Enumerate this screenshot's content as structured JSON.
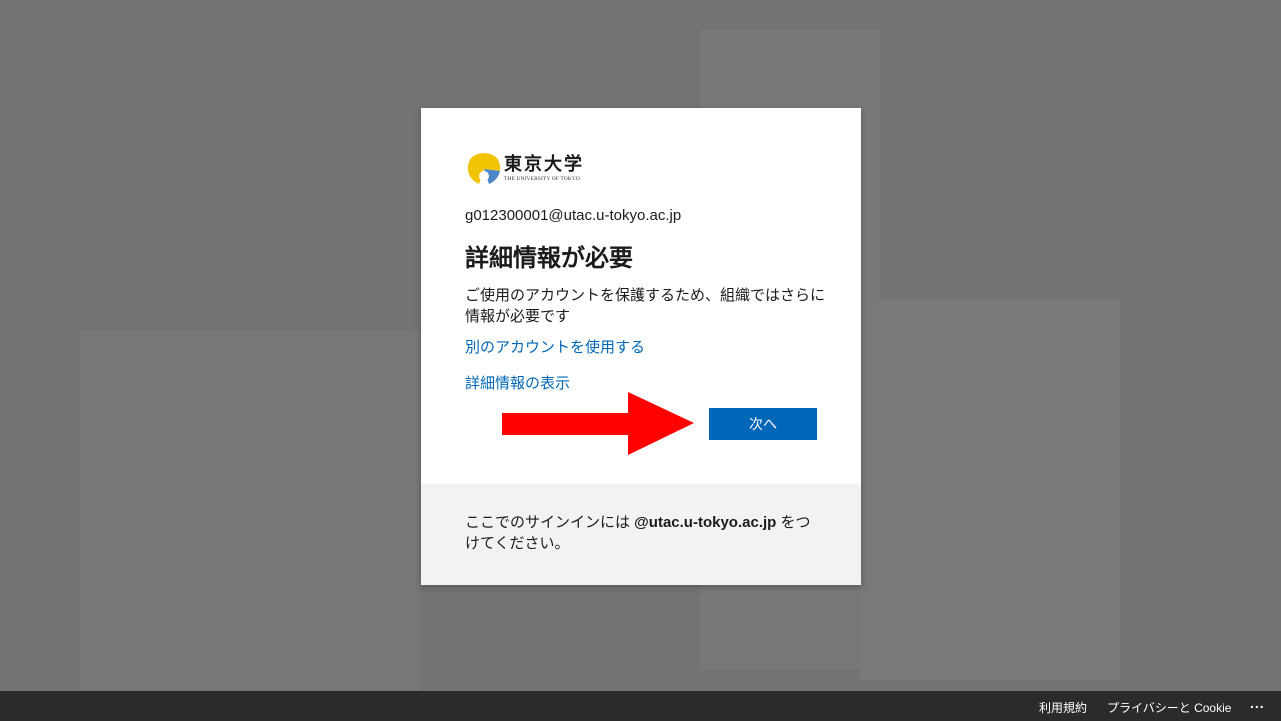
{
  "organization": {
    "name_jp": "東京大学",
    "name_en": "THE UNIVERSITY OF TOKYO"
  },
  "identity": {
    "email": "g012300001@utac.u-tokyo.ac.jp"
  },
  "dialog": {
    "title": "詳細情報が必要",
    "description": "ご使用のアカウントを保護するため、組織ではさらに情報が必要です",
    "use_other_account_link": "別のアカウントを使用する",
    "more_info_link": "詳細情報の表示",
    "next_button": "次へ"
  },
  "footer": {
    "text_before": "ここでのサインインには ",
    "domain": "@utac.u-tokyo.ac.jp",
    "text_after": " をつけてください。"
  },
  "bottom_bar": {
    "terms": "利用規約",
    "privacy": "プライバシーと Cookie",
    "more": "..."
  },
  "colors": {
    "accent": "#0067b8",
    "annotation_arrow": "#ff0000",
    "backdrop": "#737373",
    "footer_bg": "#f2f2f2",
    "bottom_bar": "#2b2b2b"
  },
  "icons": {
    "logo": "ginkgo-leaf-logo",
    "more": "ellipsis-icon",
    "annotation": "red-arrow-right"
  }
}
